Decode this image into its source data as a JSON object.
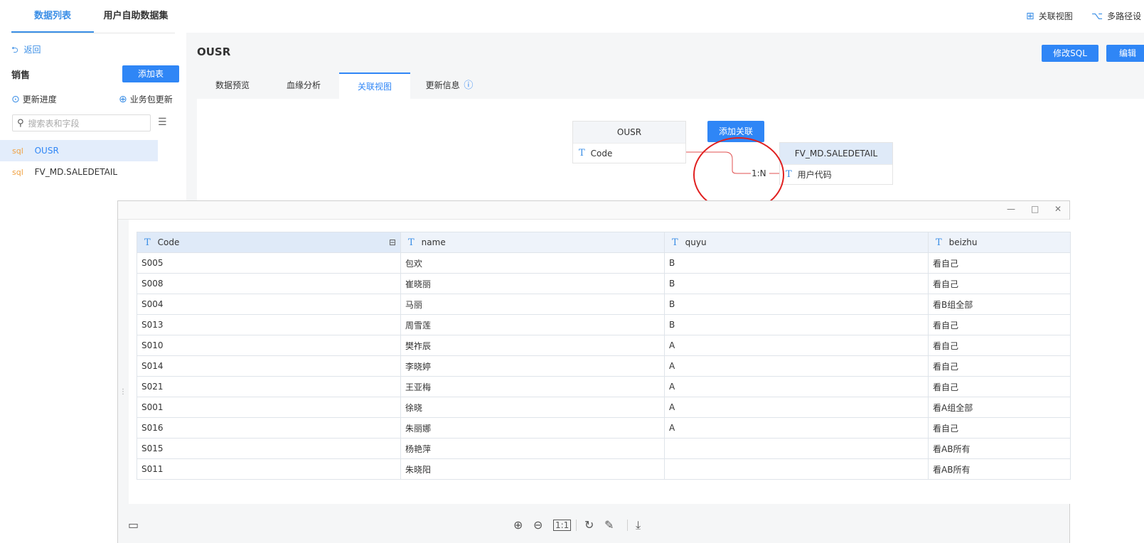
{
  "top_tabs": [
    {
      "label": "数据列表"
    },
    {
      "label": "用户自助数据集"
    }
  ],
  "top_right": {
    "relation_view": "关联视图",
    "multi_path": "多路径设"
  },
  "sidebar": {
    "back": "返回",
    "group_title": "销售",
    "add_table": "添加表",
    "update_progress": "更新进度",
    "package_update": "业务包更新",
    "search_placeholder": "搜索表和字段",
    "items": [
      {
        "type": "sql",
        "label": "OUSR"
      },
      {
        "type": "sql",
        "label": "FV_MD.SALEDETAIL"
      }
    ]
  },
  "main": {
    "title": "OUSR",
    "modify_sql": "修改SQL",
    "edit": "编辑",
    "tabs": [
      {
        "label": "数据预览"
      },
      {
        "label": "血缘分析"
      },
      {
        "label": "关联视图"
      },
      {
        "label": "更新信息"
      }
    ]
  },
  "diagram": {
    "left_table": {
      "name": "OUSR",
      "field": "Code"
    },
    "right_table": {
      "name": "FV_MD.SALEDETAIL",
      "field": "用户代码"
    },
    "add_relation": "添加关联",
    "relation_label": "1:N",
    "highlight_color": "#e02020"
  },
  "popup": {
    "columns": [
      "Code",
      "name",
      "quyu",
      "beizhu"
    ],
    "rows": [
      [
        "S005",
        "包欢",
        "B",
        "看自己"
      ],
      [
        "S008",
        "崔晓丽",
        "B",
        "看自己"
      ],
      [
        "S004",
        "马丽",
        "B",
        "看B组全部"
      ],
      [
        "S013",
        "周雪莲",
        "B",
        "看自己"
      ],
      [
        "S010",
        "樊祚辰",
        "A",
        "看自己"
      ],
      [
        "S014",
        "李晓婷",
        "A",
        "看自己"
      ],
      [
        "S021",
        "王亚梅",
        "A",
        "看自己"
      ],
      [
        "S001",
        "徐晓",
        "A",
        "看A组全部"
      ],
      [
        "S016",
        "朱丽娜",
        "A",
        "看自己"
      ],
      [
        "S015",
        "杨艳萍",
        "",
        "看AB所有"
      ],
      [
        "S011",
        "朱晓阳",
        "",
        "看AB所有"
      ]
    ]
  },
  "colors": {
    "accent": "#2f86f6",
    "active_bg": "#e3edfb",
    "sql_tag": "#f0a040"
  }
}
